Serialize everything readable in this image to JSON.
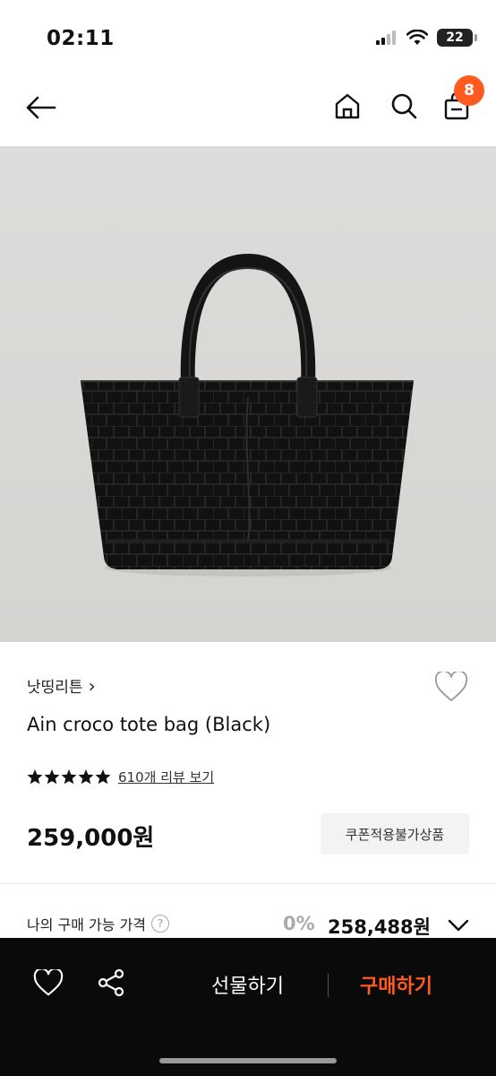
{
  "status_bar": {
    "time": "02:11",
    "battery": "22"
  },
  "nav": {
    "cart_count": "8"
  },
  "product": {
    "brand": "낫띵리튼",
    "brand_chevron": "›",
    "title": "Ain croco tote bag (Black)",
    "rating": 5,
    "review_link": "610개 리뷰 보기",
    "price": "259,000원",
    "coupon_label": "쿠폰적용불가상품"
  },
  "purchase_price": {
    "label": "나의 구매 가능 가격",
    "help": "?",
    "discount": "0%",
    "price": "258,488원"
  },
  "bottom_bar": {
    "gift_label": "선물하기",
    "buy_label": "구매하기"
  },
  "colors": {
    "accent": "#ff5a1f",
    "bottom_bar": "#0a0a0a"
  },
  "icons": [
    "back-arrow-icon",
    "home-icon",
    "search-icon",
    "cart-icon",
    "heart-outline-icon",
    "star-icon",
    "chevron-down-icon",
    "share-icon"
  ]
}
